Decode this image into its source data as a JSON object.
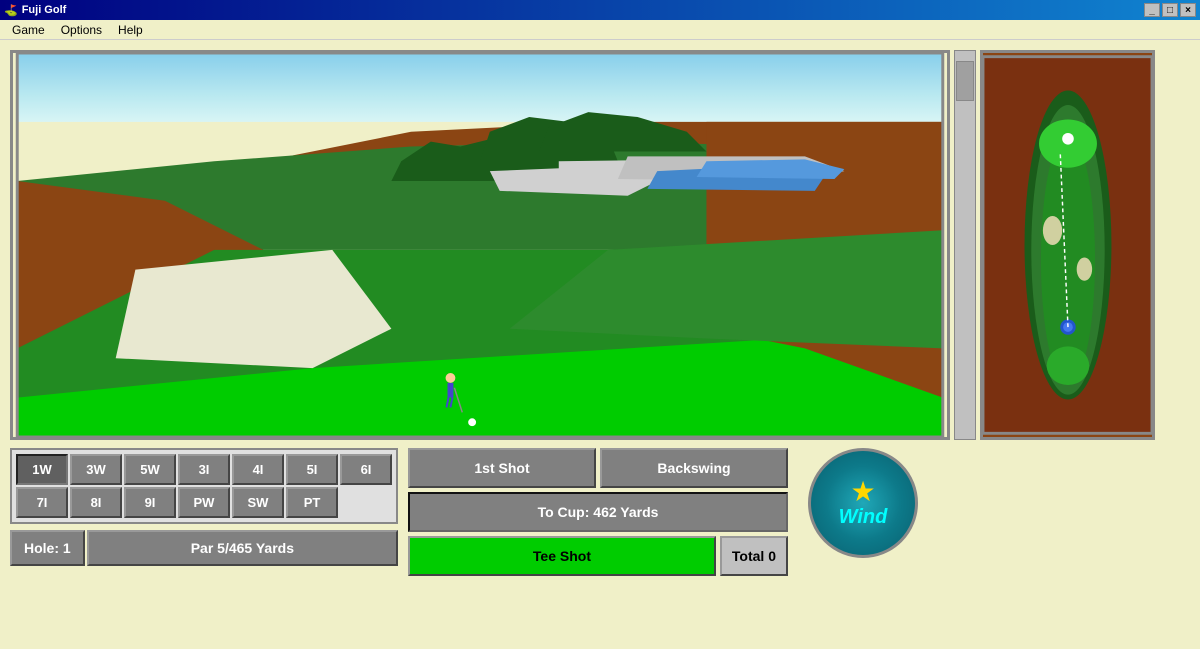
{
  "titleBar": {
    "title": "Fuji Golf",
    "buttons": [
      "_",
      "□",
      "×"
    ]
  },
  "menuBar": {
    "items": [
      "Game",
      "Options",
      "Help"
    ]
  },
  "clubs": {
    "row1": [
      "1W",
      "3W",
      "5W",
      "3I",
      "4I",
      "5I",
      "6I"
    ],
    "row2": [
      "7I",
      "8I",
      "9I",
      "PW",
      "SW",
      "PT",
      ""
    ],
    "selected": "1W"
  },
  "holeInfo": {
    "hole": "Hole: 1",
    "par": "Par 5/465 Yards"
  },
  "shotControls": {
    "firstShot": "1st Shot",
    "backswing": "Backswing",
    "toCup": "To Cup: 462 Yards",
    "teeShot": "Tee Shot",
    "total": "Total 0"
  },
  "wind": {
    "label": "Wind"
  }
}
